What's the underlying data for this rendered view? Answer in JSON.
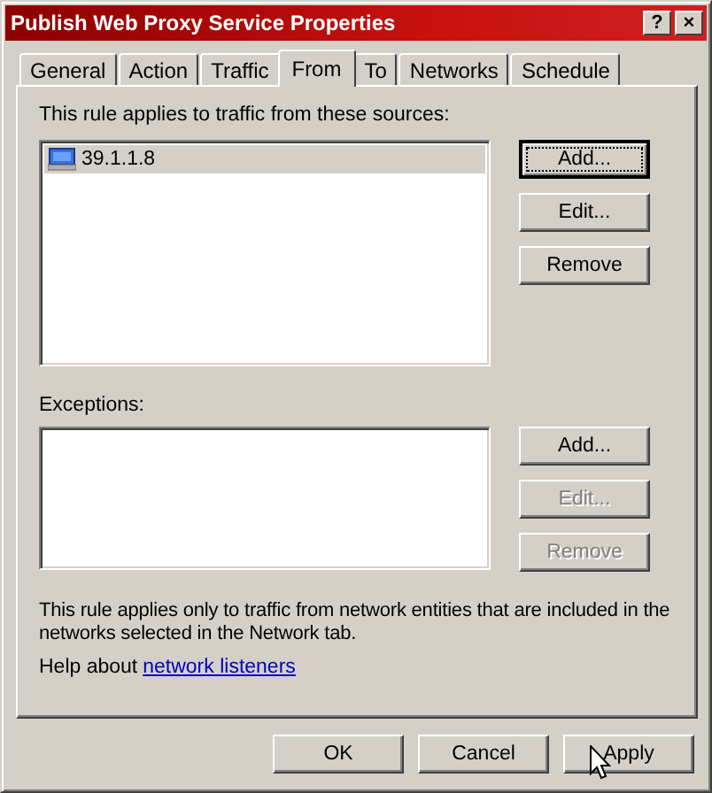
{
  "window": {
    "title": "Publish Web Proxy Service Properties",
    "controls": [
      "?",
      "×"
    ]
  },
  "tabs": [
    {
      "label": "General",
      "selected": false
    },
    {
      "label": "Action",
      "selected": false
    },
    {
      "label": "Traffic",
      "selected": false
    },
    {
      "label": "From",
      "selected": true
    },
    {
      "label": "To",
      "selected": false
    },
    {
      "label": "Networks",
      "selected": false
    },
    {
      "label": "Schedule",
      "selected": false
    }
  ],
  "sources": {
    "label": "This rule applies to traffic from these sources:",
    "items": [
      {
        "text": "39.1.1.8",
        "selected": true
      }
    ],
    "buttons": [
      {
        "label": "Add...",
        "disabled": false,
        "default": true
      },
      {
        "label": "Edit...",
        "disabled": false,
        "default": false
      },
      {
        "label": "Remove",
        "disabled": false,
        "default": false
      }
    ]
  },
  "exceptions": {
    "label": "Exceptions:",
    "buttons": [
      {
        "label": "Add...",
        "disabled": false,
        "default": false
      },
      {
        "label": "Edit...",
        "disabled": true,
        "default": false
      },
      {
        "label": "Remove",
        "disabled": true,
        "default": false
      }
    ]
  },
  "note": "This rule applies only to traffic from network entities that are included in the networks selected in the Network tab.",
  "help": {
    "text": "Help about",
    "link": "network listeners"
  },
  "footer_buttons": [
    {
      "label": "OK",
      "disabled": false
    },
    {
      "label": "Cancel",
      "disabled": false
    },
    {
      "label": "Apply",
      "disabled": false
    }
  ]
}
